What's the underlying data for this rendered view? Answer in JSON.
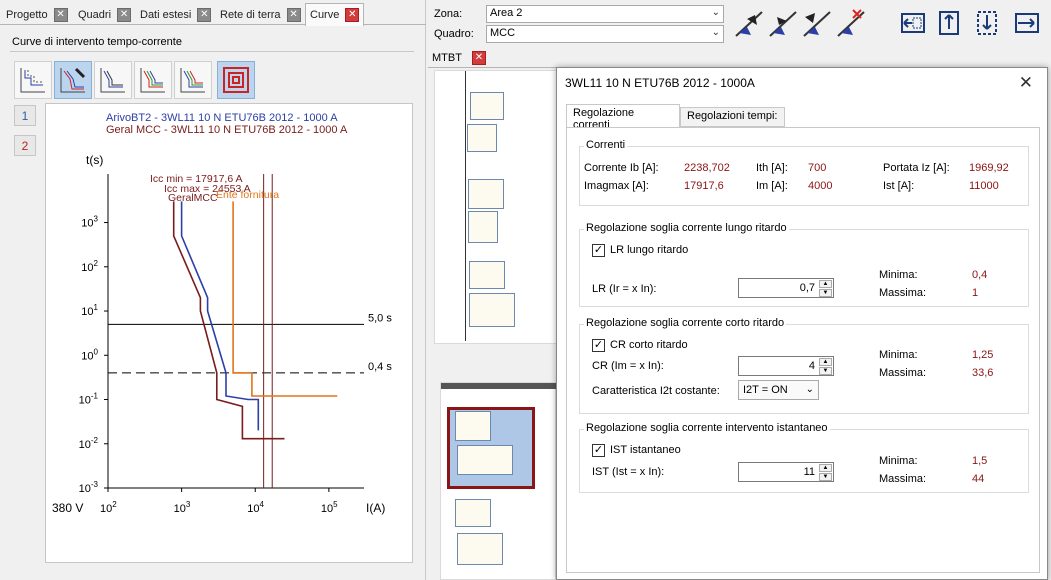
{
  "left_tabs": [
    {
      "label": "Progetto"
    },
    {
      "label": "Quadri"
    },
    {
      "label": "Dati estesi"
    },
    {
      "label": "Rete di terra"
    },
    {
      "label": "Curve"
    }
  ],
  "panel_title": "Curve di intervento tempo-corrente",
  "toolbar_icons": [
    "curve-view-1-icon",
    "curve-view-2-icon",
    "curve-view-3-icon",
    "curve-view-4-icon",
    "curve-view-5-icon",
    "concentric-squares-icon"
  ],
  "side_numbers": [
    "1",
    "2"
  ],
  "chart_data": {
    "type": "line",
    "x_scale": "log",
    "y_scale": "log",
    "xlabel": "I(A)",
    "ylabel": "t(s)",
    "voltage_label": "380 V",
    "x_ticks": [
      {
        "base": "10",
        "exp": "2"
      },
      {
        "base": "10",
        "exp": "3"
      },
      {
        "base": "10",
        "exp": "4"
      },
      {
        "base": "10",
        "exp": "5"
      }
    ],
    "y_ticks": [
      {
        "base": "10",
        "exp": "3"
      },
      {
        "base": "10",
        "exp": "2"
      },
      {
        "base": "10",
        "exp": "1"
      },
      {
        "base": "10",
        "exp": "0"
      },
      {
        "base": "10",
        "exp": "-1"
      },
      {
        "base": "10",
        "exp": "-2"
      },
      {
        "base": "10",
        "exp": "-3"
      }
    ],
    "series": [
      {
        "name": "ArivoBT2 - 3WL11 10 N ETU76B 2012 - 1000 A",
        "color": "#2b3fa6",
        "points": [
          [
            1000,
            3000
          ],
          [
            1000,
            500
          ],
          [
            2250,
            20
          ],
          [
            2250,
            10
          ],
          [
            4000,
            0.4
          ],
          [
            4000,
            0.12
          ],
          [
            8000,
            0.1
          ],
          [
            11000,
            0.1
          ],
          [
            11000,
            0.02
          ]
        ]
      },
      {
        "name": "Geral MCC - 3WL11 10 N ETU76B 2012 - 1000 A",
        "color": "#7a1c1c",
        "points": [
          [
            780,
            3000
          ],
          [
            780,
            500
          ],
          [
            1800,
            20
          ],
          [
            1800,
            10
          ],
          [
            3000,
            0.4
          ],
          [
            3000,
            0.1
          ],
          [
            6700,
            0.07
          ],
          [
            6700,
            0.013
          ],
          [
            25000,
            0.013
          ]
        ]
      },
      {
        "name": "Ente fornitura",
        "color": "#e0751a",
        "points": [
          [
            5000,
            3000
          ],
          [
            5000,
            0.4
          ],
          [
            9000,
            0.4
          ],
          [
            9000,
            0.12
          ],
          [
            130000,
            0.12
          ]
        ]
      }
    ],
    "vlines": [
      {
        "label": "Icc min = 17917,6 A",
        "x": 13000,
        "color": "#7a1c1c"
      },
      {
        "label": "Icc max = 24553 A",
        "x": 17000,
        "color": "#7a1c1c"
      }
    ],
    "hlines": [
      {
        "label": "5,0 s",
        "y": 5,
        "style": "solid"
      },
      {
        "label": "0,4 s",
        "y": 0.4,
        "style": "dashed"
      }
    ],
    "overlay_labels": [
      {
        "text": "GeralMCC"
      },
      {
        "text": "Ente fornitura"
      }
    ]
  },
  "zona": {
    "label": "Zona:",
    "value": "Area 2"
  },
  "quadro": {
    "label": "Quadro:",
    "value": "MCC"
  },
  "toolbar_right_icons": [
    "arrow-left-flag-icon",
    "arrow-right-flag-icon",
    "arrow-back-flag-icon",
    "delete-flag-icon",
    "panel-left-icon",
    "panel-up-icon",
    "panel-down-icon",
    "panel-right-icon"
  ],
  "schematic_tab": "MTBT",
  "dialog": {
    "title": "3WL11 10 N ETU76B 2012 - 1000A",
    "tabs": [
      "Regolazione correnti",
      "Regolazioni tempi:"
    ],
    "correnti": {
      "legend": "Correnti",
      "ib_label": "Corrente Ib [A]:",
      "ib_val": "2238,702",
      "imagmax_label": "Imagmax [A]:",
      "imagmax_val": "17917,6",
      "ith_label": "Ith [A]:",
      "ith_val": "700",
      "im_label": "Im [A]:",
      "im_val": "4000",
      "iz_label": "Portata Iz [A]:",
      "iz_val": "1969,92",
      "ist_label": "Ist [A]:",
      "ist_val": "11000"
    },
    "lr": {
      "legend": "Regolazione soglia corrente lungo ritardo",
      "check_label": "LR lungo ritardo",
      "field_label": "LR (Ir = x In):",
      "value": "0,7",
      "min_label": "Minima:",
      "min_val": "0,4",
      "max_label": "Massima:",
      "max_val": "1"
    },
    "cr": {
      "legend": "Regolazione soglia corrente corto ritardo",
      "check_label": "CR corto ritardo",
      "field_label": "CR (Im = x In):",
      "value": "4",
      "char_label": "Caratteristica I2t costante:",
      "char_val": "I2T = ON",
      "min_label": "Minima:",
      "min_val": "1,25",
      "max_label": "Massima:",
      "max_val": "33,6"
    },
    "ist": {
      "legend": "Regolazione soglia corrente intervento istantaneo",
      "check_label": "IST istantaneo",
      "field_label": "IST (Ist = x In):",
      "value": "11",
      "min_label": "Minima:",
      "min_val": "1,5",
      "max_label": "Massima:",
      "max_val": "44"
    }
  }
}
